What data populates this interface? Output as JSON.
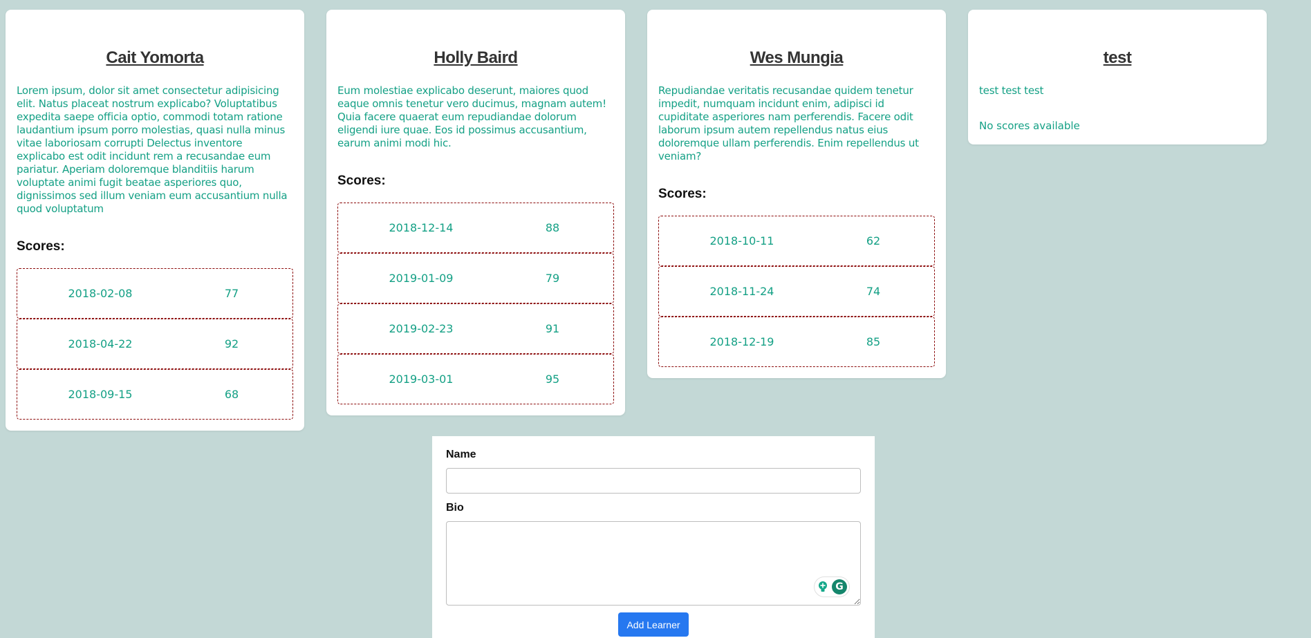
{
  "learners": [
    {
      "name": "Cait Yomorta",
      "bio": "Lorem ipsum, dolor sit amet consectetur adipisicing elit. Natus placeat nostrum explicabo? Voluptatibus expedita saepe officia optio, commodi totam ratione laudantium ipsum porro molestias, quasi nulla minus vitae laboriosam corrupti Delectus inventore explicabo est odit incidunt rem a recusandae eum pariatur. Aperiam doloremque blanditiis harum voluptate animi fugit beatae asperiores quo, dignissimos sed illum veniam eum accusantium nulla quod voluptatum",
      "scores_heading": "Scores:",
      "scores": [
        {
          "date": "2018-02-08",
          "score": "77"
        },
        {
          "date": "2018-04-22",
          "score": "92"
        },
        {
          "date": "2018-09-15",
          "score": "68"
        }
      ]
    },
    {
      "name": "Holly Baird",
      "bio": "Eum molestiae explicabo deserunt, maiores quod eaque omnis tenetur vero ducimus, magnam autem! Quia facere quaerat eum repudiandae dolorum eligendi iure quae. Eos id possimus accusantium, earum animi modi hic.",
      "scores_heading": "Scores:",
      "scores": [
        {
          "date": "2018-12-14",
          "score": "88"
        },
        {
          "date": "2019-01-09",
          "score": "79"
        },
        {
          "date": "2019-02-23",
          "score": "91"
        },
        {
          "date": "2019-03-01",
          "score": "95"
        }
      ]
    },
    {
      "name": "Wes Mungia",
      "bio": "Repudiandae veritatis recusandae quidem tenetur impedit, numquam incidunt enim, adipisci id cupiditate asperiores nam perferendis. Facere odit laborum ipsum autem repellendus natus eius doloremque ullam perferendis. Enim repellendus ut veniam?",
      "scores_heading": "Scores:",
      "scores": [
        {
          "date": "2018-10-11",
          "score": "62"
        },
        {
          "date": "2018-11-24",
          "score": "74"
        },
        {
          "date": "2018-12-19",
          "score": "85"
        }
      ]
    },
    {
      "name": "test",
      "bio": "test test test",
      "no_scores_text": "No scores available"
    }
  ],
  "form": {
    "name_label": "Name",
    "name_value": "",
    "bio_label": "Bio",
    "bio_value": "",
    "submit_label": "Add Learner"
  },
  "colors": {
    "page_background": "#c3d8d6",
    "text_accent": "#14a085",
    "score_border": "#8b0a0a",
    "button": "#2678f0"
  },
  "icons": {
    "grammarly_bulb": "lightbulb-plus-icon",
    "grammarly_logo": "grammarly-g-icon"
  }
}
